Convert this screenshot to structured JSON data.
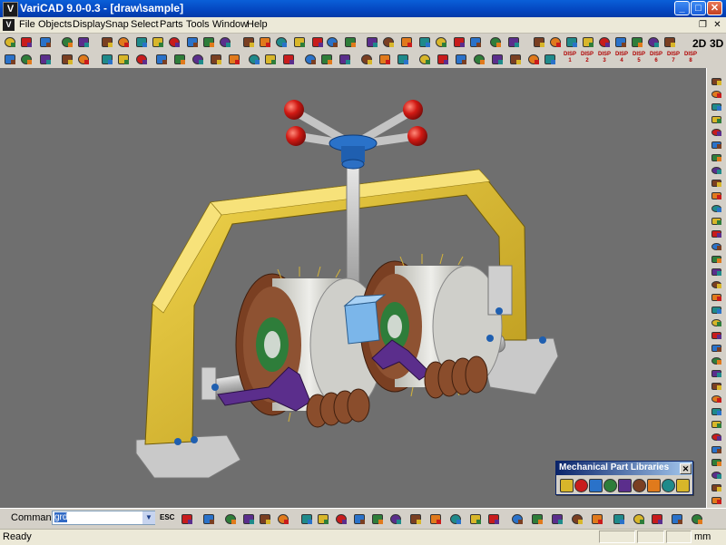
{
  "window": {
    "app_icon": "V",
    "title": "VariCAD 9.0-0.3 - [draw\\sample]",
    "minimize": "_",
    "maximize": "□",
    "close": "✕"
  },
  "menu": {
    "icon": "V",
    "items": [
      "File",
      "Objects",
      "Display",
      "Snap",
      "Select",
      "Parts",
      "Tools",
      "Window",
      "Help"
    ],
    "restore": "❐",
    "close": "✕"
  },
  "toolbar": {
    "mode_2d": "2D",
    "mode_3d": "3D",
    "disp_top": [
      "DISP",
      "DISP",
      "DISP",
      "DISP",
      "DISP",
      "DISP",
      "DISP",
      "DISP"
    ],
    "disp_bottom": [
      "1",
      "2",
      "3",
      "4",
      "5",
      "6",
      "7",
      "8"
    ]
  },
  "command": {
    "label": "Command:",
    "value": "grd",
    "esc": "ESC"
  },
  "status": {
    "text": "Ready",
    "unit": "mm"
  },
  "palette": {
    "title": "Mechanical Part Libraries",
    "close": "✕"
  },
  "colors": {
    "title_blue": "#0446c0",
    "viewport_gray": "#6f6f6f",
    "frame_yellow": "#d8b62a",
    "arm_purple": "#5b2e8c",
    "knob_red": "#c81c1c",
    "hub_blue": "#2a72c9"
  }
}
